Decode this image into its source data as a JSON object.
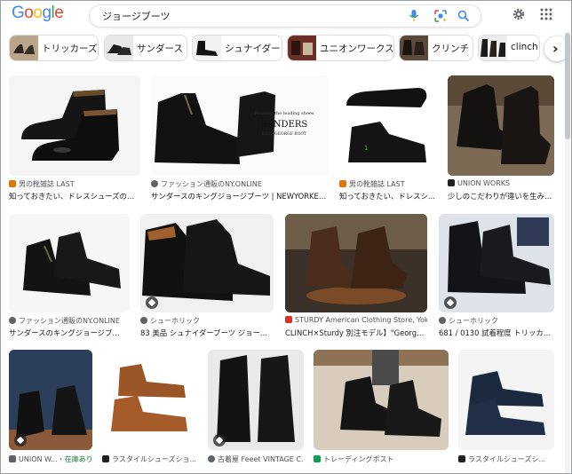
{
  "header": {
    "logo": [
      "G",
      "o",
      "o",
      "g",
      "l",
      "e"
    ],
    "logo_colors": [
      "#4285F4",
      "#EA4335",
      "#FBBC05",
      "#4285F4",
      "#34A853",
      "#EA4335"
    ],
    "search_value": "ジョージブーツ"
  },
  "chips": [
    {
      "label": "トリッカーズ"
    },
    {
      "label": "サンダース"
    },
    {
      "label": "シュナイダー"
    },
    {
      "label": "ユニオンワークス"
    },
    {
      "label": "クリンチ"
    },
    {
      "label": "clinch"
    }
  ],
  "results": [
    {
      "source": "男の靴雑誌 LAST",
      "title": "知っておきたい、ドレスシューズのス...",
      "favicon": "#e37400"
    },
    {
      "source": "ファッション通販のNY.ONLINE",
      "title": "サンダースのキングジョージブーツ | NEWYORKER M...",
      "favicon": "#5f6368"
    },
    {
      "source": "男の靴雑誌 LAST",
      "title": "知っておきたい、ドレスシ...",
      "favicon": "#e37400"
    },
    {
      "source": "UNION WORKS",
      "title": "少しのこだわりが違いを生みま...",
      "favicon": "#202124"
    },
    {
      "source": "ファッション通販のNY.ONLINE",
      "title": "サンダースのキングジョージブ...",
      "favicon": "#5f6368"
    },
    {
      "source": "シューホリック",
      "title": "83 美品 シュナイダーブーツ ジョージブ...",
      "favicon": "#5f6368"
    },
    {
      "source": "STURDY American Clothing Store, Yoko...",
      "title": "CLINCH×Sturdy 別注モデル】\"George Boot...",
      "favicon": "#d93025"
    },
    {
      "source": "シューホリック",
      "title": "681 / 0130 試着程度 トリッカー...",
      "favicon": "#5f6368"
    },
    {
      "source": "UNION W...",
      "stock": "・在庫あり",
      "favicon": "#5f6368"
    },
    {
      "source": "ラスタイルシューズショ...",
      "favicon": "#202124"
    },
    {
      "source": "古着屋 Feeet VINTAGE C...",
      "favicon": "#5f6368"
    },
    {
      "source": "トレーディングポスト",
      "favicon": "#0f9d58"
    },
    {
      "source": "ラスタイルシューズシ...",
      "favicon": "#202124"
    }
  ],
  "icons": {
    "mic": "mic-icon",
    "lens": "google-lens-icon",
    "search": "search-icon",
    "settings": "gear-icon",
    "apps": "apps-grid-icon",
    "next": "chevron-right-icon",
    "tag": "product-tag-icon"
  }
}
